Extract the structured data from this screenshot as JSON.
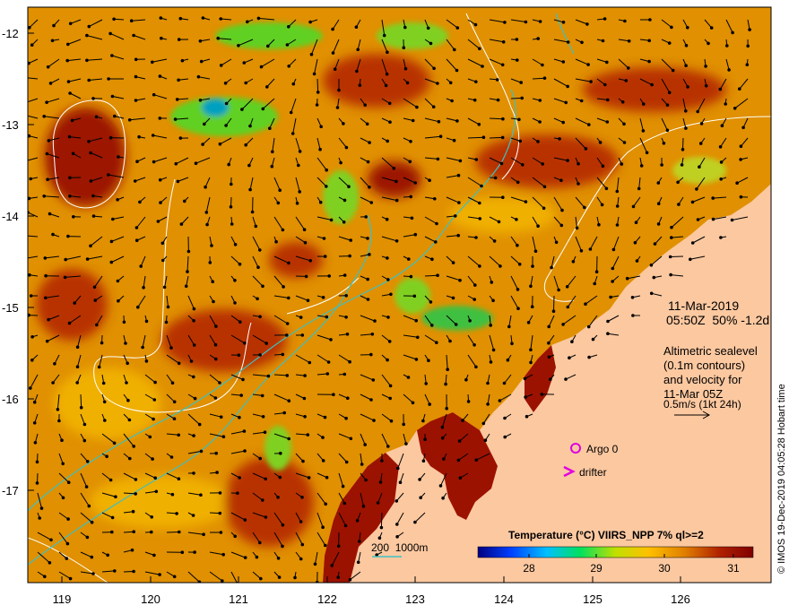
{
  "map": {
    "date": "11-Mar-2019",
    "time_info": "05:50Z  50% -1.2d",
    "lat_labels": [
      "-12",
      "-13",
      "-14",
      "-15",
      "-16",
      "-17"
    ],
    "lon_labels": [
      "119",
      "120",
      "121",
      "122",
      "123",
      "124",
      "125",
      "126"
    ],
    "altimetry_note": [
      "Altimetric sealevel",
      "(0.1m contours)",
      "and velocity for",
      "11-Mar 05Z"
    ],
    "velocity_scale": "0.5m/s (1kt 24h)",
    "argo_label": "Argo 0",
    "drifter_label": "drifter",
    "bathy_label": "200  1000m",
    "credit": "© IMOS 19-Dec-2019 04:05:28 Hobart time"
  },
  "colorbar": {
    "title": "Temperature (°C) VIIRS_NPP 7% ql>=2",
    "ticks": [
      "28",
      "29",
      "30",
      "31"
    ],
    "colors": [
      "#000080",
      "#0040ff",
      "#00c0ff",
      "#00e060",
      "#c0e000",
      "#ffc000",
      "#e08000",
      "#b02000",
      "#800000"
    ]
  },
  "colors": {
    "land": "#fcc8a0",
    "sst_base": "#e09000",
    "sst_warm": "#b83000",
    "sst_hot": "#9c1200",
    "sst_cool": "#60d020",
    "argo": "#e000e0",
    "bathy": "#40c0c0",
    "contour": "#ffffff"
  }
}
